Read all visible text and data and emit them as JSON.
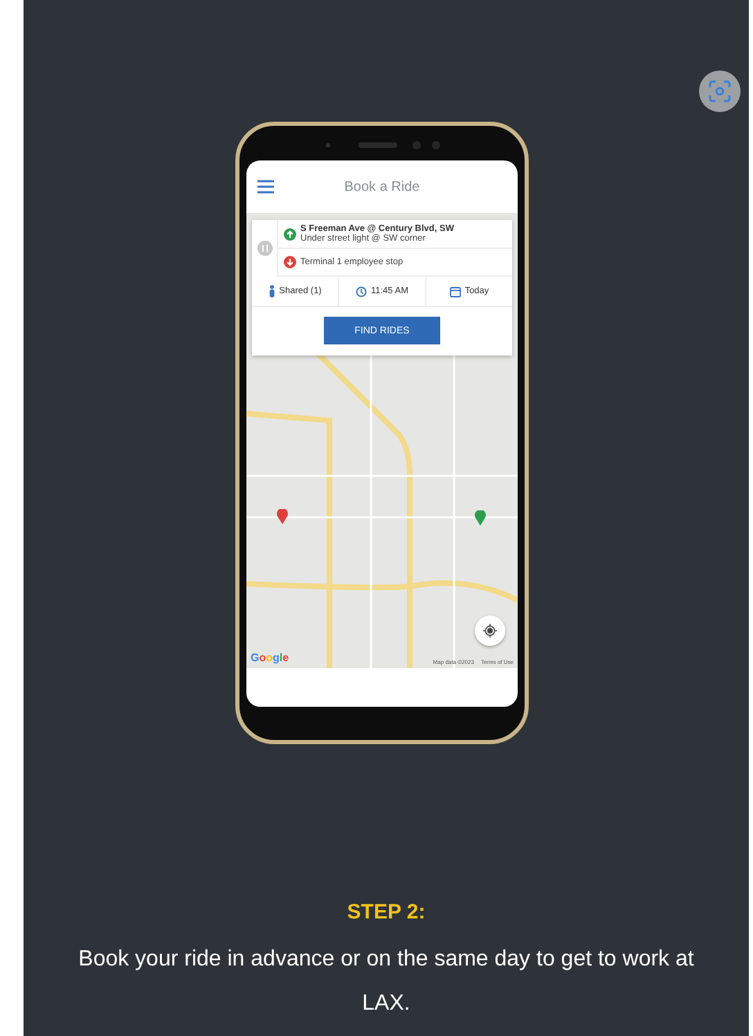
{
  "app": {
    "title": "Book a Ride"
  },
  "trip": {
    "pickup": {
      "name": "S Freeman Ave @ Century Blvd, SW",
      "detail": "Under street light @ SW corner"
    },
    "dropoff": {
      "name": "Terminal 1 employee stop"
    }
  },
  "options": [
    {
      "kind": "riders",
      "label": "Shared (1)"
    },
    {
      "kind": "time",
      "label": "11:45 AM"
    },
    {
      "kind": "date",
      "label": "Today"
    }
  ],
  "action": {
    "label": "FIND RIDES"
  },
  "map": {
    "logo": "Google",
    "attribution": [
      "Map data ©2023",
      "Terms of Use"
    ]
  },
  "step": {
    "title": "STEP 2:",
    "text": "Book your ride in advance or on the same day to get to work at LAX."
  }
}
